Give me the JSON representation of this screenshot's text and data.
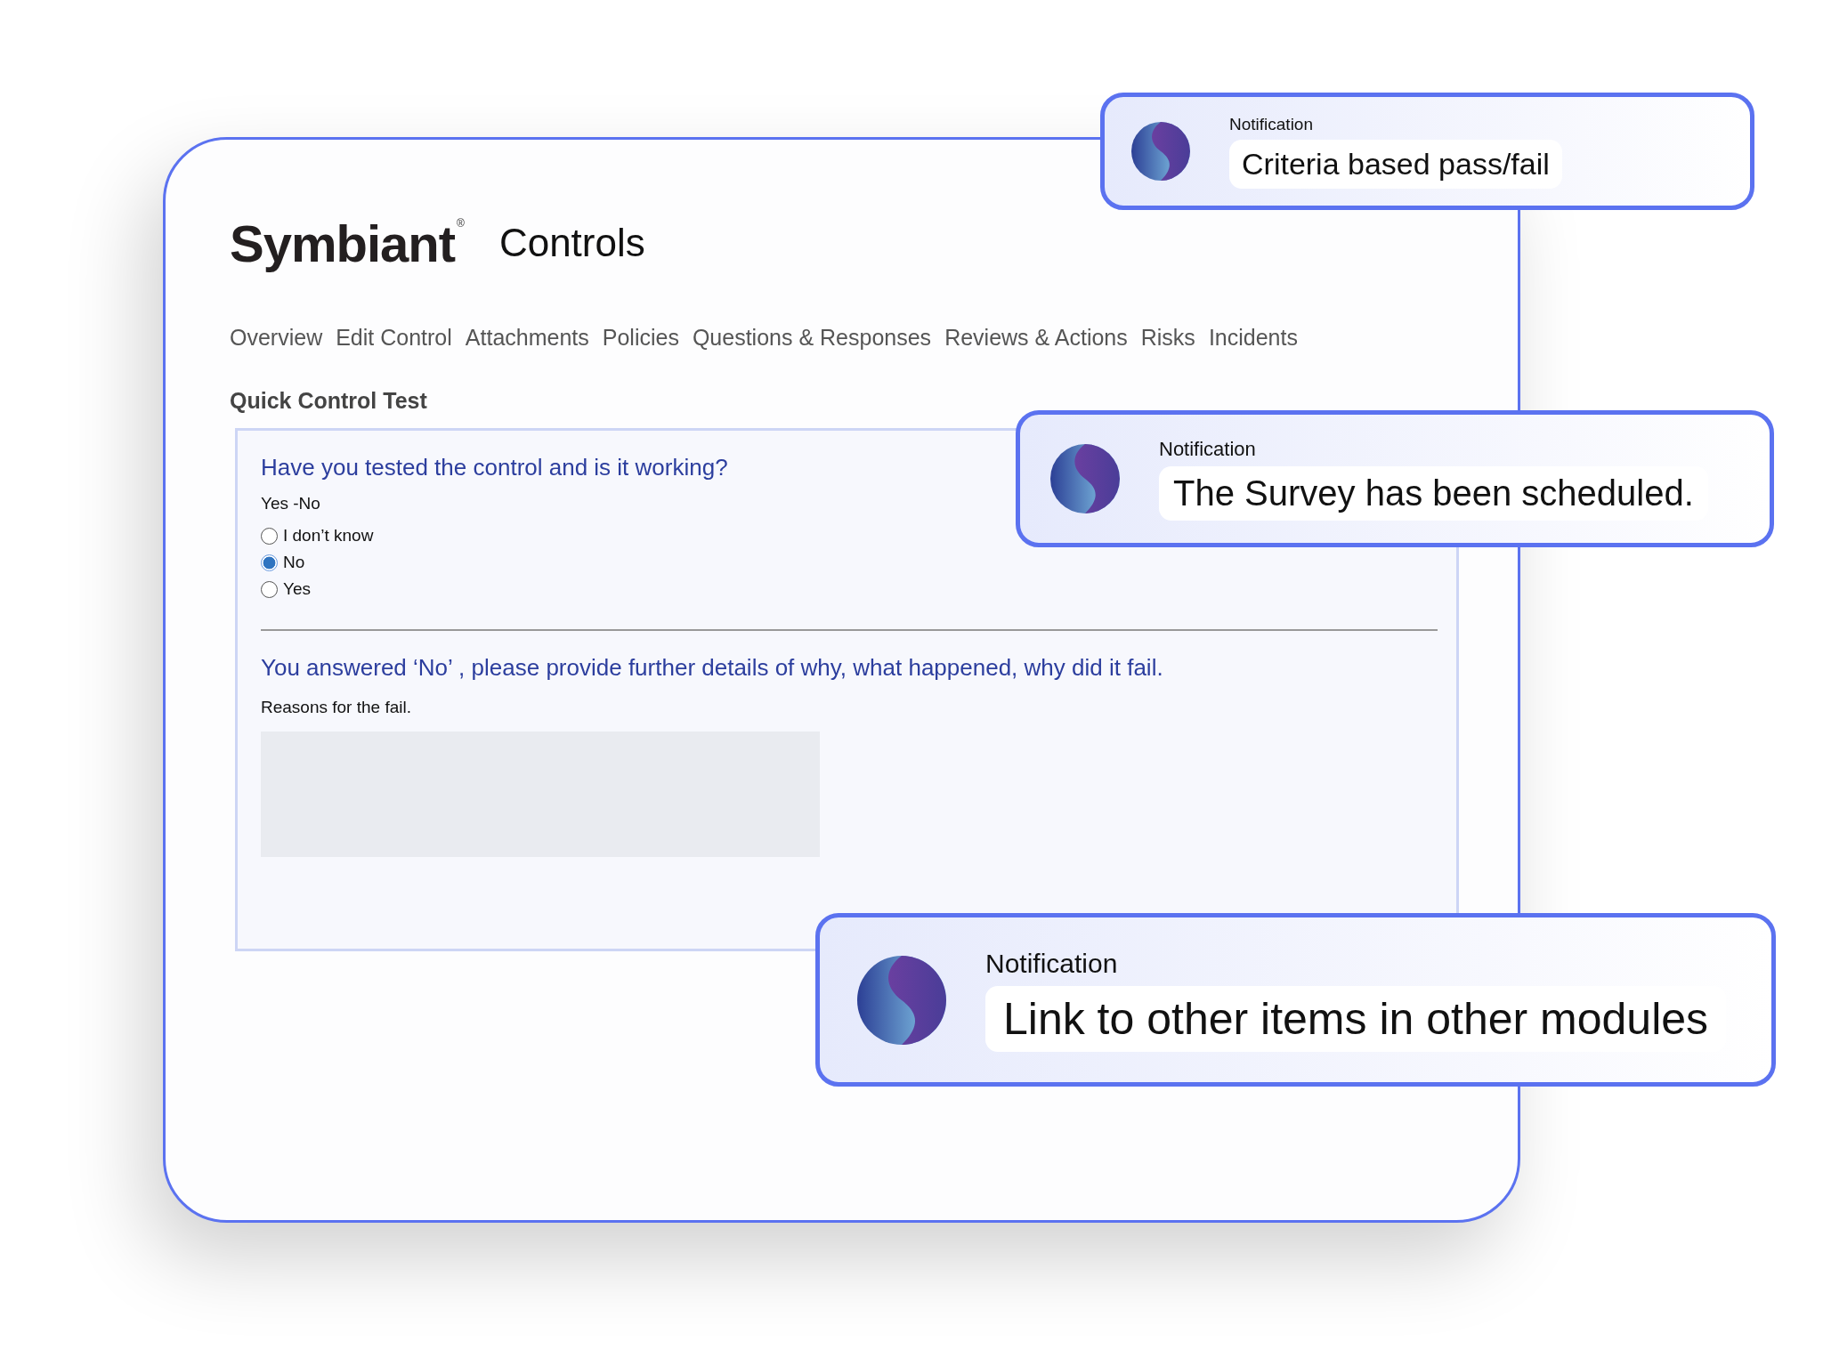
{
  "app": {
    "logo": "Symbiant",
    "logo_mark": "®",
    "module": "Controls"
  },
  "tabs": [
    {
      "label": "Overview",
      "selected": false
    },
    {
      "label": "Edit Control",
      "selected": false
    },
    {
      "label": "Attachments",
      "selected": false
    },
    {
      "label": "Policies",
      "selected": false
    },
    {
      "label": "Questions & Responses",
      "selected": false
    },
    {
      "label": "Reviews & Actions",
      "selected": false
    },
    {
      "label": "Risks",
      "selected": false
    },
    {
      "label": "Incidents",
      "selected": false
    }
  ],
  "section_title": "Quick Control Test",
  "question": {
    "text": "Have you tested the control and is it working?",
    "type_label": "Yes -No",
    "options": [
      {
        "label": "I don’t know",
        "selected": false
      },
      {
        "label": "No",
        "selected": true
      },
      {
        "label": "Yes",
        "selected": false
      }
    ]
  },
  "followup": {
    "text": "You answered ‘No’ , please provide further details of why, what happened, why did it fail.",
    "field_label": "Reasons for the fail."
  },
  "notifications": [
    {
      "kind": "small",
      "label": "Notification",
      "message": "Criteria based pass/fail"
    },
    {
      "kind": "medium",
      "label": "Notification",
      "message": "The Survey has been scheduled."
    },
    {
      "kind": "large",
      "label": "Notification",
      "message": "Link to other items in other modules"
    }
  ]
}
